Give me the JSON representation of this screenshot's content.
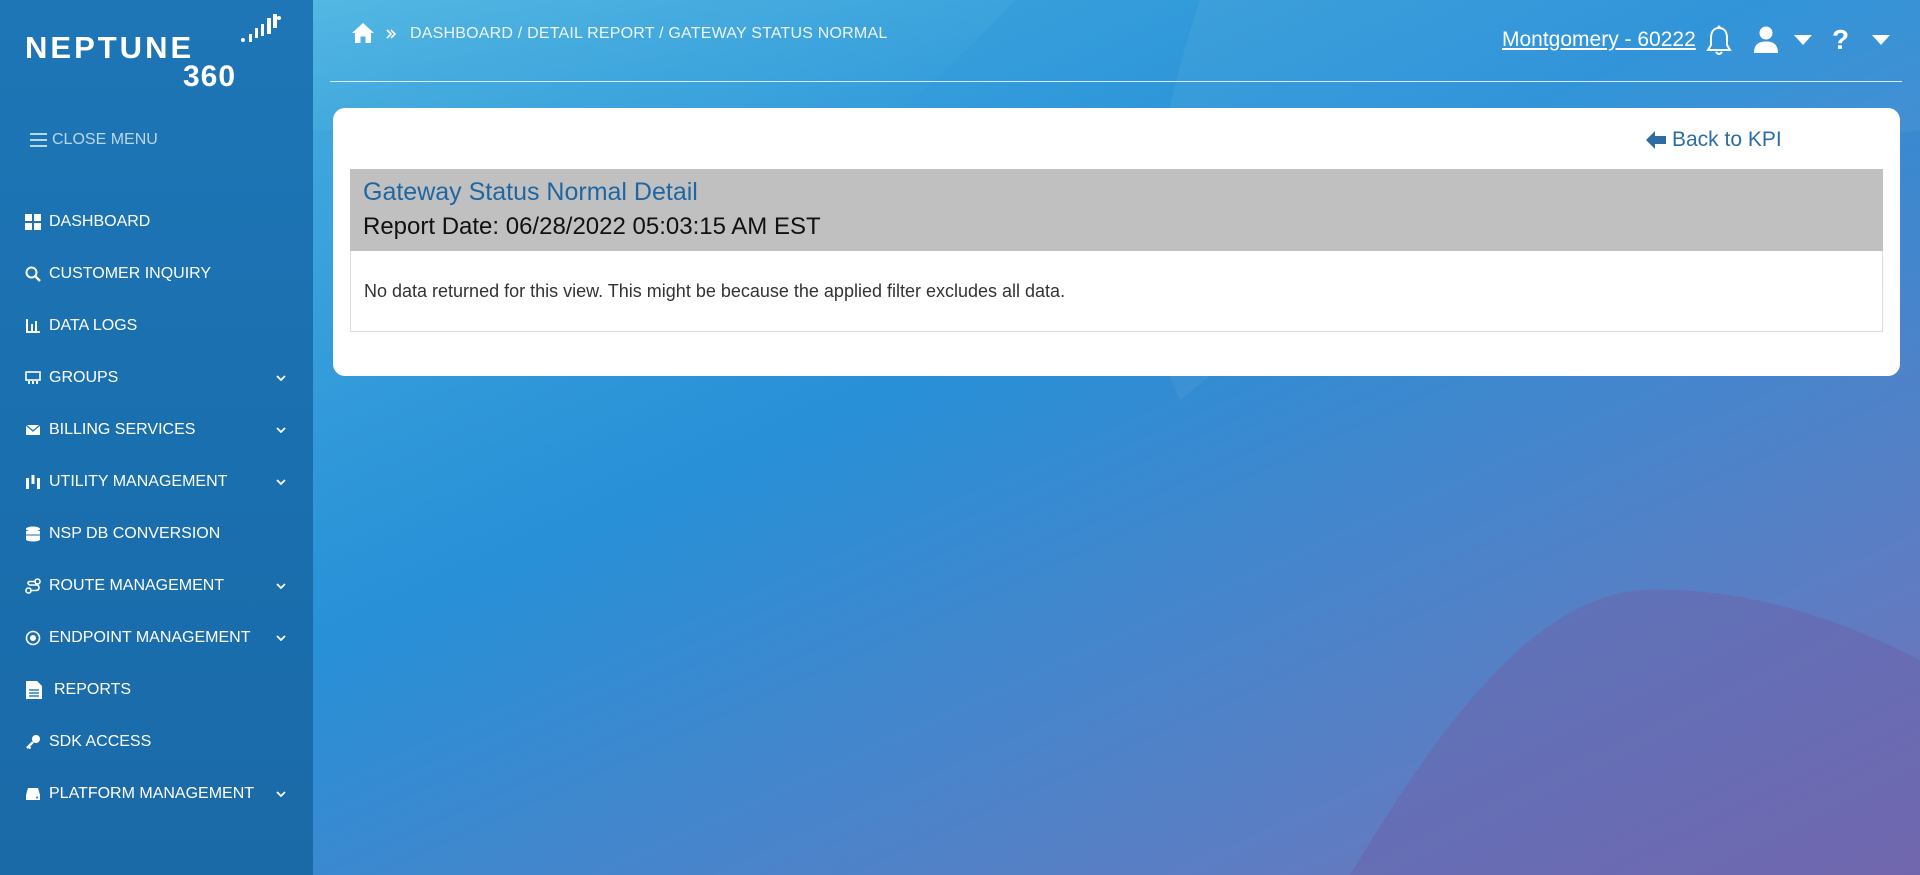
{
  "brand": {
    "name": "NEPTUNE",
    "sub": "360"
  },
  "sidebar": {
    "close_menu": "CLOSE MENU",
    "items": [
      {
        "label": "DASHBOARD",
        "icon": "grid-icon",
        "expandable": false
      },
      {
        "label": "CUSTOMER INQUIRY",
        "icon": "search-icon",
        "expandable": false
      },
      {
        "label": "DATA LOGS",
        "icon": "bar-chart-icon",
        "expandable": false
      },
      {
        "label": "GROUPS",
        "icon": "groups-icon",
        "expandable": true
      },
      {
        "label": "BILLING SERVICES",
        "icon": "envelope-icon",
        "expandable": true
      },
      {
        "label": "UTILITY MANAGEMENT",
        "icon": "sliders-icon",
        "expandable": true
      },
      {
        "label": "NSP DB CONVERSION",
        "icon": "database-icon",
        "expandable": false
      },
      {
        "label": "ROUTE MANAGEMENT",
        "icon": "route-icon",
        "expandable": true
      },
      {
        "label": "ENDPOINT MANAGEMENT",
        "icon": "endpoint-icon",
        "expandable": true
      },
      {
        "label": "REPORTS",
        "icon": "document-icon",
        "expandable": false
      },
      {
        "label": "SDK ACCESS",
        "icon": "key-icon",
        "expandable": false
      },
      {
        "label": "PLATFORM MANAGEMENT",
        "icon": "drive-icon",
        "expandable": true
      }
    ]
  },
  "header": {
    "breadcrumb": "DASHBOARD / DETAIL REPORT / GATEWAY STATUS NORMAL",
    "account": "Montgomery - 60222",
    "help": "?"
  },
  "report": {
    "back_label": "Back to KPI",
    "title": "Gateway Status Normal Detail",
    "date": "Report Date: 06/28/2022 05:03:15 AM EST",
    "empty_message": "No data returned for this view. This might be because the applied filter excludes all data."
  },
  "colors": {
    "sidebar": "#1e76b6",
    "accent": "#1e67a3",
    "header_band": "#c0c0c0"
  }
}
